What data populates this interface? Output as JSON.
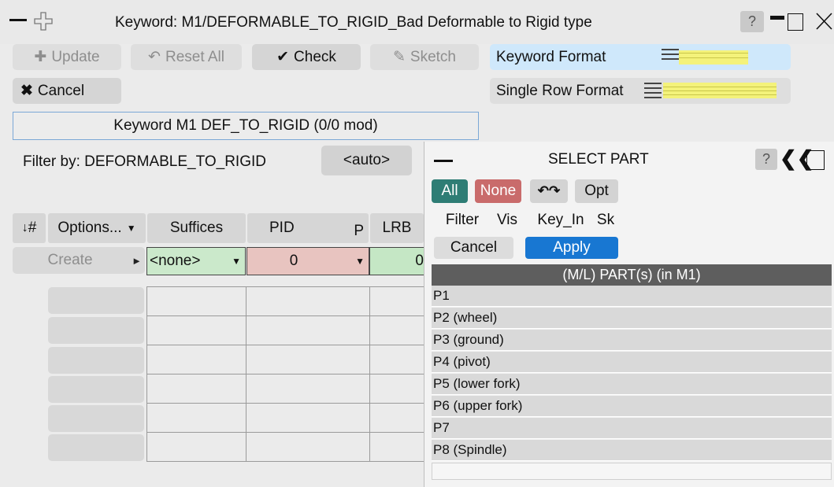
{
  "window": {
    "title": "Keyword: M1/DEFORMABLE_TO_RIGID_Bad Deformable to Rigid type",
    "help_label": "?"
  },
  "toolbar": {
    "update_label": "Update",
    "reset_all_label": "Reset All",
    "check_label": "Check",
    "sketch_label": "Sketch",
    "cancel_label": "Cancel",
    "keyword_format_label": "Keyword Format",
    "single_row_format_label": "Single Row Format"
  },
  "keyword_tab": {
    "label": "Keyword M1 DEF_TO_RIGID (0/0 mod)"
  },
  "filter": {
    "label": "Filter by: DEFORMABLE_TO_RIGID",
    "auto_label": "<auto>"
  },
  "table": {
    "headers": {
      "number": "#",
      "options": "Options...",
      "suffices": "Suffices",
      "pid": "PID",
      "p": "P",
      "lrb": "LRB"
    },
    "create_label": "Create",
    "suffix_value": "<none>",
    "pid_value": "0",
    "lrb_value": "0"
  },
  "select_part": {
    "title": "SELECT PART",
    "help_label": "?",
    "all_label": "All",
    "none_label": "None",
    "opt_label": "Opt",
    "filter_label": "Filter",
    "vis_label": "Vis",
    "key_in_label": "Key_In",
    "sk_label": "Sk",
    "cancel_label": "Cancel",
    "apply_label": "Apply",
    "list_header": "(M/L) PART(s) (in M1)",
    "parts": [
      "P1",
      "P2 (wheel)",
      "P3 (ground)",
      "P4 (pivot)",
      "P5 (lower fork)",
      "P6 (upper fork)",
      "P7",
      "P8 (Spindle)"
    ]
  },
  "colors": {
    "all_button": "#2e7d75",
    "none_button": "#c96b6b",
    "apply_button": "#1877d2",
    "pid_cell": "#e8c4c0",
    "lrb_cell": "#c5e7c5",
    "list_header": "#5e5e5e"
  }
}
